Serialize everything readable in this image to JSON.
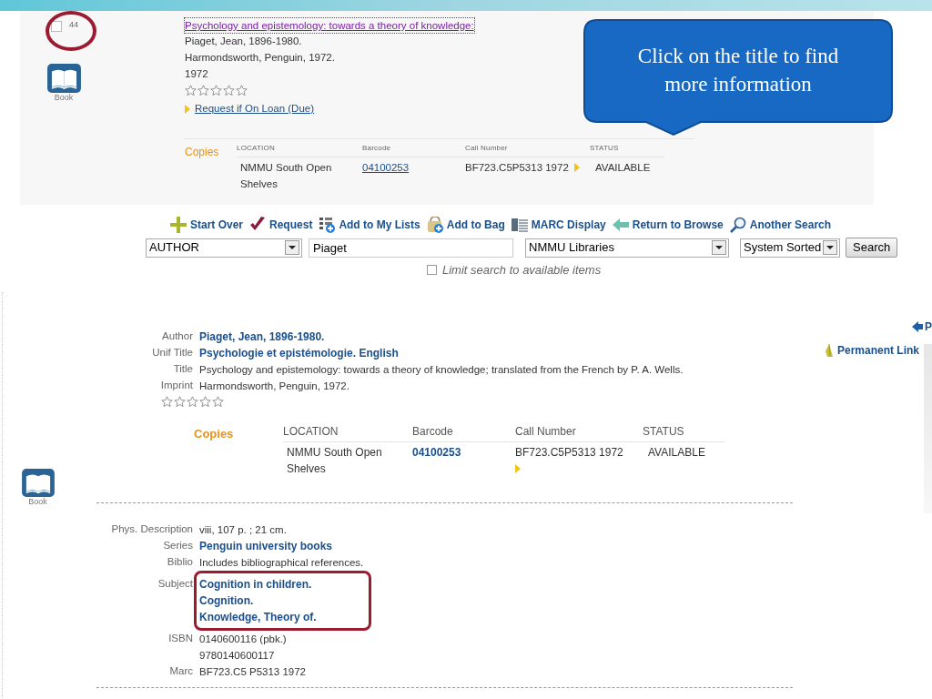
{
  "callout": {
    "text": "Click on the title to find more information"
  },
  "result": {
    "checked": false,
    "number": "44",
    "format": "Book",
    "title": "Psychology and epistemology: towards a theory of knowledge:",
    "lines": [
      "Piaget, Jean, 1896-1980.",
      "Harmondsworth, Penguin, 1972.",
      "1972"
    ],
    "stars": 0,
    "request_link": "Request if On Loan (Due)",
    "copies": {
      "label": "Copies",
      "columns": [
        "LOCATION",
        "Barcode",
        "Call Number",
        "STATUS"
      ],
      "rows": [
        {
          "location": "NMMU South Open Shelves",
          "barcode": "04100253",
          "call_number": "BF723.C5P5313 1972",
          "status": "AVAILABLE"
        }
      ]
    }
  },
  "toolbar": [
    {
      "kind": "plus",
      "label": "Start Over"
    },
    {
      "kind": "check",
      "label": "Request"
    },
    {
      "kind": "list",
      "label": "Add to My Lists"
    },
    {
      "kind": "bag",
      "label": "Add to Bag"
    },
    {
      "kind": "marc",
      "label": "MARC Display"
    },
    {
      "kind": "back",
      "label": "Return to Browse"
    },
    {
      "kind": "search",
      "label": "Another Search"
    }
  ],
  "search": {
    "field": "AUTHOR",
    "query": "Piaget",
    "scope": "NMMU Libraries",
    "sort": "System Sorted",
    "button": "Search",
    "limit_label": "Limit search to available items",
    "limit_checked": false
  },
  "record": {
    "nav": "P",
    "permanent_link": "Permanent Link",
    "format": "Book",
    "fields": [
      {
        "label": "Author",
        "kind": "link",
        "values": [
          "Piaget, Jean, 1896-1980."
        ]
      },
      {
        "label": "Unif Title",
        "kind": "link",
        "values": [
          "Psychologie et epistémologie. English"
        ]
      },
      {
        "label": "Title",
        "kind": "text",
        "values": [
          "Psychology and epistemology: towards a theory of knowledge; translated from the French by P. A. Wells."
        ]
      },
      {
        "label": "Imprint",
        "kind": "text",
        "values": [
          "Harmondsworth, Penguin, 1972."
        ]
      }
    ],
    "stars": 0,
    "copies": {
      "label": "Copies",
      "columns": [
        "LOCATION",
        "Barcode",
        "Call Number",
        "STATUS"
      ],
      "rows": [
        {
          "location": "NMMU South Open Shelves",
          "barcode": "04100253",
          "call_number": "BF723.C5P5313 1972",
          "status": "AVAILABLE"
        }
      ]
    },
    "details": [
      {
        "label": "Phys. Description",
        "kind": "text",
        "highlighted": false,
        "values": [
          "viii, 107 p. ; 21 cm."
        ]
      },
      {
        "label": "Series",
        "kind": "link",
        "highlighted": false,
        "values": [
          "Penguin university books"
        ]
      },
      {
        "label": "Biblio",
        "kind": "text",
        "highlighted": false,
        "values": [
          "Includes bibliographical references."
        ]
      },
      {
        "label": "Subject",
        "kind": "link",
        "highlighted": true,
        "values": [
          "Cognition in children.",
          "Cognition.",
          "Knowledge, Theory of."
        ]
      },
      {
        "label": "ISBN",
        "kind": "text",
        "highlighted": false,
        "values": [
          "0140600116 (pbk.)",
          "9780140600117"
        ]
      },
      {
        "label": "Marc",
        "kind": "text",
        "highlighted": false,
        "values": [
          "BF723.C5 P5313 1972"
        ]
      }
    ]
  }
}
